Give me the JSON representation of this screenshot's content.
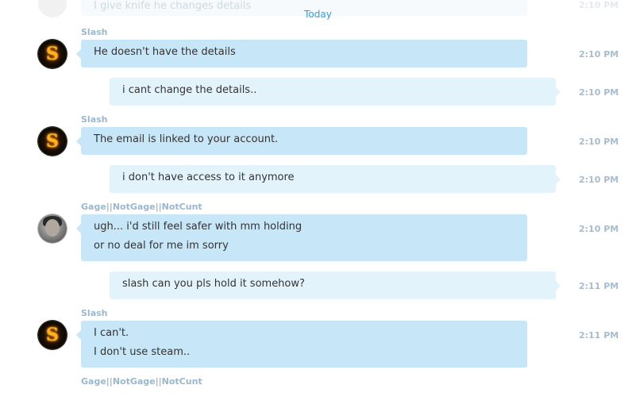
{
  "partial_top": {
    "text": "I give knife he changes details",
    "time": "2:10 PM"
  },
  "day_divider": "Today",
  "messages": [
    {
      "sender": "Slash",
      "lines": [
        "He doesn't have the details"
      ],
      "time": "2:10 PM",
      "direction": "incoming",
      "avatar": "slash-avatar"
    },
    {
      "lines": [
        "i cant change the details.."
      ],
      "time": "2:10 PM",
      "direction": "outgoing"
    },
    {
      "sender": "Slash",
      "lines": [
        "The email is linked to your account."
      ],
      "time": "2:10 PM",
      "direction": "incoming",
      "avatar": "slash-avatar"
    },
    {
      "lines": [
        "i don't have access to it anymore"
      ],
      "time": "2:10 PM",
      "direction": "outgoing"
    },
    {
      "sender": "Gage||NotGage||NotCunt",
      "lines": [
        "ugh... i'd still feel safer with mm holding",
        "or no deal for me im sorry"
      ],
      "time": "2:10 PM",
      "direction": "incoming",
      "avatar": "gage-avatar"
    },
    {
      "lines": [
        "slash can you pls hold it somehow?"
      ],
      "time": "2:11 PM",
      "direction": "outgoing"
    },
    {
      "sender": "Slash",
      "lines": [
        "I can't.",
        "I don't use steam.."
      ],
      "time": "2:11 PM",
      "direction": "incoming",
      "avatar": "slash-avatar"
    }
  ],
  "typing_sender": "Gage||NotGage||NotCunt",
  "colors": {
    "incoming_bubble": "#c7e6f8",
    "outgoing_bubble": "#e2f3fc",
    "accent": "#2f9ed6",
    "sender_name": "#9ab7cc",
    "timestamp": "#a8bccb"
  }
}
